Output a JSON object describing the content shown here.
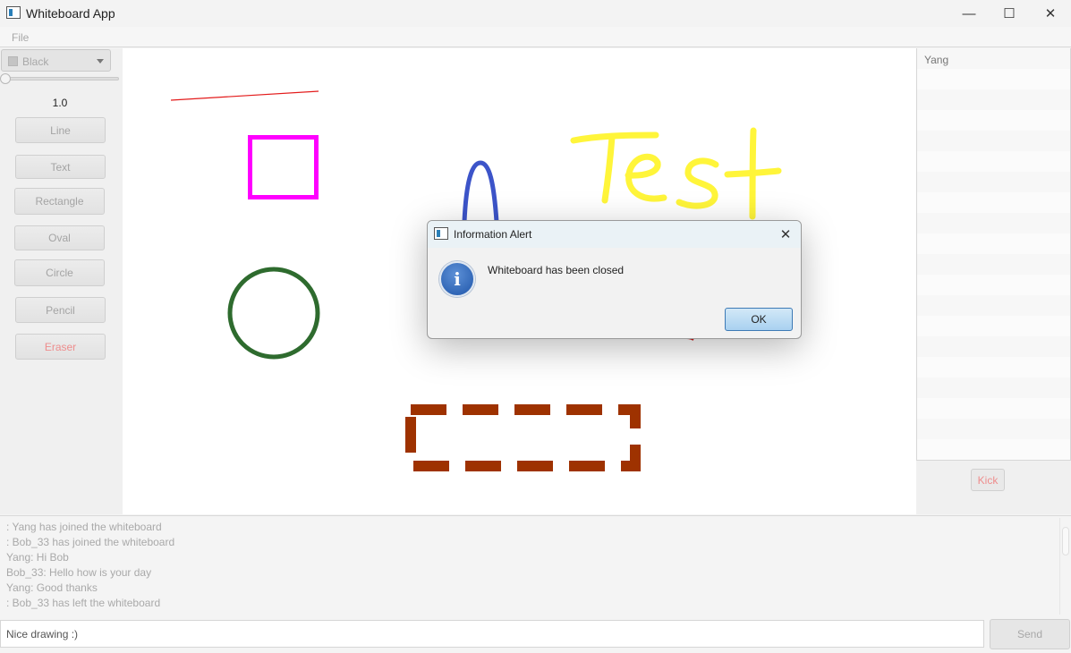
{
  "window": {
    "title": "Whiteboard App",
    "icon": "app-window-icon",
    "controls": {
      "minimize": "—",
      "maximize": "☐",
      "close": "✕"
    }
  },
  "menu": {
    "file": "File"
  },
  "tools": {
    "color": {
      "label": "Black",
      "swatch": "#c4c4c4"
    },
    "stroke_width": "1.0",
    "buttons": [
      "Line",
      "Text",
      "Rectangle",
      "Oval",
      "Circle",
      "Pencil",
      "Eraser"
    ]
  },
  "canvas": {
    "text_shape": "Test",
    "colors": {
      "line": "#e31b1b",
      "rectangle": "#ff00ff",
      "circle": "#2e6b2e",
      "oval": "#3c54c9",
      "text": "#fff53a",
      "eraser_box": "#9e3200"
    }
  },
  "users": {
    "items": [
      "Yang"
    ],
    "kick_label": "Kick"
  },
  "chat": {
    "messages": [
      ": Yang has joined the whiteboard",
      ": Bob_33 has joined the whiteboard",
      "Yang: Hi Bob",
      "Bob_33: Hello how is your day",
      "Yang: Good thanks",
      ": Bob_33 has left the whiteboard"
    ],
    "input_value": "Nice drawing :)",
    "send_label": "Send"
  },
  "dialog": {
    "title": "Information Alert",
    "icon_letter": "i",
    "message": "Whiteboard has been closed",
    "ok_label": "OK",
    "close_glyph": "✕"
  }
}
